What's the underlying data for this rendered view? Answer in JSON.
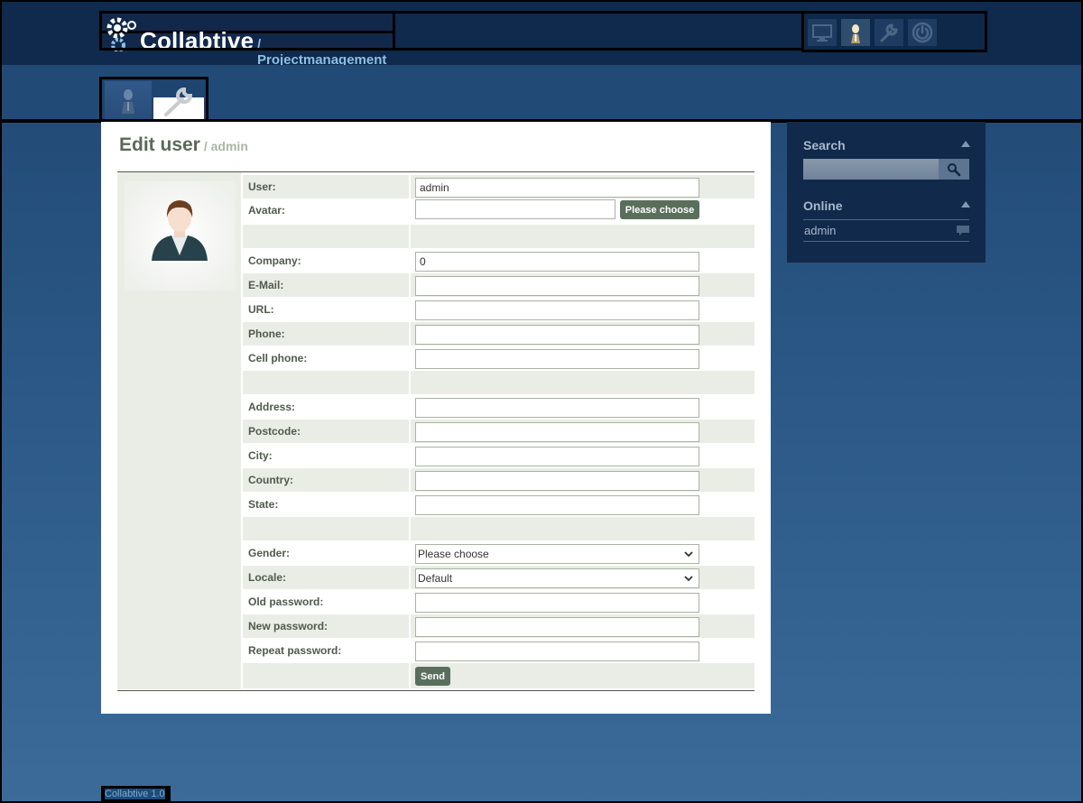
{
  "header": {
    "app_name": "Collabtive",
    "app_subtitle": "/ Projectmanagement",
    "icons": [
      "desktop-icon",
      "user-icon",
      "wrench-icon",
      "power-icon"
    ]
  },
  "tabs": [
    {
      "icon": "user-icon",
      "active": false
    },
    {
      "icon": "wrench-icon",
      "active": true
    }
  ],
  "page": {
    "title": "Edit user",
    "subtitle": "/ admin"
  },
  "form": {
    "user_label": "User:",
    "user_value": "admin",
    "avatar_label": "Avatar:",
    "avatar_button": "Please choose",
    "company_label": "Company:",
    "company_value": "0",
    "email_label": "E-Mail:",
    "url_label": "URL:",
    "phone_label": "Phone:",
    "cell_label": "Cell phone:",
    "address_label": "Address:",
    "postcode_label": "Postcode:",
    "city_label": "City:",
    "country_label": "Country:",
    "state_label": "State:",
    "gender_label": "Gender:",
    "gender_value": "Please choose",
    "locale_label": "Locale:",
    "locale_value": "Default",
    "oldpass_label": "Old password:",
    "newpass_label": "New password:",
    "repeatpass_label": "Repeat password:",
    "send_button": "Send"
  },
  "sidebar": {
    "search_heading": "Search",
    "online_heading": "Online",
    "online_user": "admin"
  },
  "footer": {
    "text": "Collabtive 1.0"
  },
  "colors": {
    "header_bg": "#0f2a4c",
    "button_bg": "#5a6e5c",
    "row_alt_bg": "#e9ede6",
    "subtitle_blue": "#8cc0e8"
  }
}
